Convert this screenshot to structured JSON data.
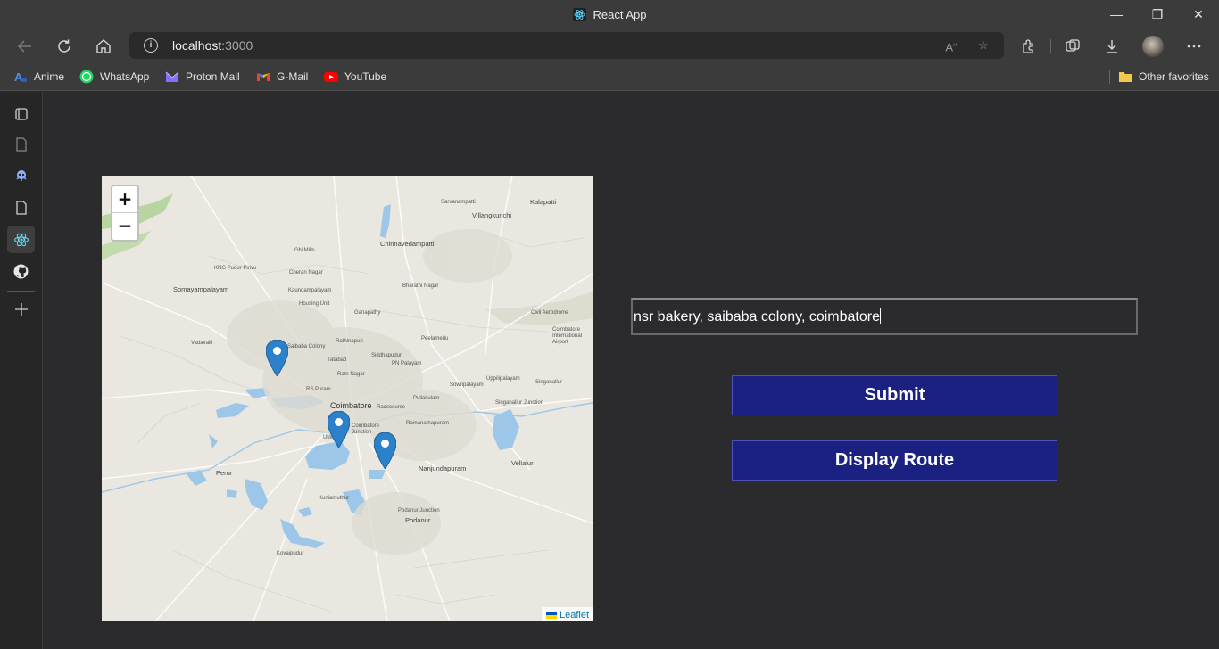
{
  "window": {
    "title": "React App",
    "minimize_glyph": "—",
    "restore_glyph": "❐",
    "close_glyph": "✕"
  },
  "toolbar": {
    "url_host": "localhost",
    "url_port": ":3000"
  },
  "bookmarks": [
    {
      "label": "Anime",
      "icon": "anime-icon",
      "color": "#3a7bd5"
    },
    {
      "label": "WhatsApp",
      "icon": "whatsapp-icon",
      "color": "#25d366"
    },
    {
      "label": "Proton Mail",
      "icon": "proton-mail-icon",
      "color": "#8a6cff"
    },
    {
      "label": "G-Mail",
      "icon": "gmail-icon",
      "color": "#ea4335"
    },
    {
      "label": "YouTube",
      "icon": "youtube-icon",
      "color": "#ff0000"
    }
  ],
  "other_favorites": "Other favorites",
  "map": {
    "zoom_in": "+",
    "zoom_out": "−",
    "attribution": "Leaflet",
    "places": [
      "Sarvanampatti",
      "Kalapatti",
      "Villangkurichi",
      "Chinnavedampatti",
      "GN Mills",
      "KNG Pudur Pirivu",
      "Cheran Nagar",
      "Somayampalayam",
      "Kaundampalayam",
      "Bharathi Nagar",
      "Housing Unit",
      "Ganapathy",
      "Civil Aerodrome",
      "Coimbatore International Airport",
      "Vadavalli",
      "Saibaba Colony",
      "Rathinapuri",
      "Peelamedu",
      "Tatabad",
      "Siddhapudur",
      "PN Palayam",
      "Ram Nagar",
      "Sowripalayam",
      "Uppilipalayam",
      "Singanallur",
      "RS Puram",
      "Coimbatore",
      "Pullakulam",
      "Racecourse",
      "Singanallur Junction",
      "Coimbatore Junction",
      "Ramanathapuram",
      "Ukkadam",
      "Perur",
      "Nanjundapuram",
      "Vellalur",
      "Kuniamuthur",
      "Podanur Junction",
      "Podanur",
      "Kovaipudur"
    ],
    "colors": {
      "land": "#e9e7df",
      "water": "#9cc7e8",
      "green": "#b7d5a0",
      "marker": "#2b82cb"
    }
  },
  "form": {
    "input_value": "nsr bakery, saibaba colony, coimbatore",
    "submit_label": "Submit",
    "display_route_label": "Display Route",
    "button_color": "#1b2180"
  }
}
